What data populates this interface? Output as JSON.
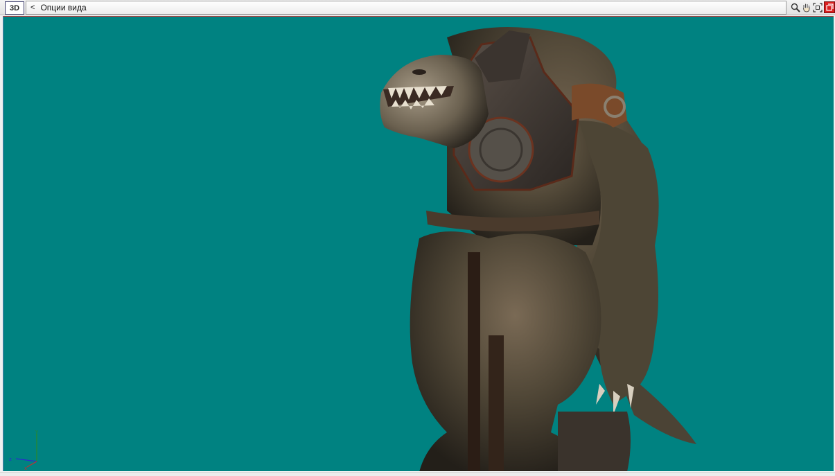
{
  "toolbar": {
    "mode_label": "3D",
    "options_chevron": "<",
    "options_label": "Опции вида",
    "tools": [
      {
        "icon": "zoom-icon"
      },
      {
        "icon": "pan-hand-icon"
      },
      {
        "icon": "fit-view-icon"
      },
      {
        "icon": "restore-icon"
      }
    ]
  },
  "viewport": {
    "background_color": "#008281",
    "axis_labels": {
      "y": "y",
      "z": "z",
      "x": "x"
    }
  }
}
